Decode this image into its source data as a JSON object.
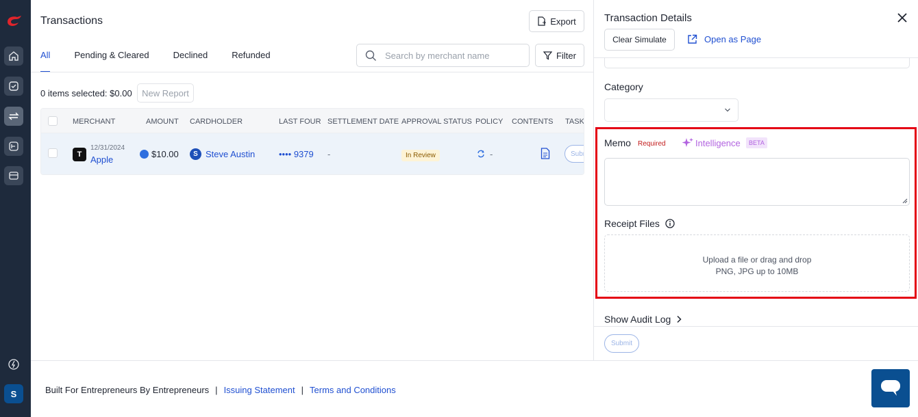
{
  "main": {
    "title": "Transactions",
    "export_label": "Export",
    "tabs": [
      {
        "label": "All"
      },
      {
        "label": "Pending & Cleared"
      },
      {
        "label": "Declined"
      },
      {
        "label": "Refunded"
      }
    ],
    "search": {
      "placeholder": "Search by merchant name"
    },
    "filter_label": "Filter",
    "selection_text": "0 items selected: $0.00",
    "new_report_label": "New Report",
    "table": {
      "headers": [
        "MERCHANT",
        "AMOUNT",
        "CARDHOLDER",
        "LAST FOUR",
        "SETTLEMENT DATE",
        "APPROVAL STATUS",
        "POLICY",
        "CONTENTS",
        "TASKS"
      ],
      "rows": [
        {
          "merchant_initial": "T",
          "date": "12/31/2024",
          "merchant": "Apple",
          "amount": "$10.00",
          "cardholder_initial": "S",
          "cardholder": "Steve Austin",
          "last_four": "•••• 9379",
          "settlement_date": "-",
          "approval_status": "In Review",
          "policy": "-",
          "task_label": "Submit"
        }
      ]
    }
  },
  "rail": {
    "avatar_initial": "S"
  },
  "panel": {
    "title": "Transaction Details",
    "clear_simulate_label": "Clear Simulate",
    "open_as_page_label": "Open as Page",
    "category_label": "Category",
    "memo_label": "Memo",
    "memo_required": "Required",
    "intelligence_label": "Intelligence",
    "beta_label": "BETA",
    "receipt_label": "Receipt Files",
    "upload_line1": "Upload a file or drag and drop",
    "upload_line2": "PNG, JPG up to 10MB",
    "audit_label": "Show Audit Log",
    "submit_label": "Submit"
  },
  "footer": {
    "tagline": "Built For Entrepreneurs By Entrepreneurs",
    "sep": "|",
    "issuing_statement": "Issuing Statement",
    "terms": "Terms and Conditions"
  },
  "colors": {
    "accent": "#1f4fd1",
    "rail_bg": "#1e2a3c",
    "highlight": "#e40014",
    "brand_red": "#e0242b"
  }
}
